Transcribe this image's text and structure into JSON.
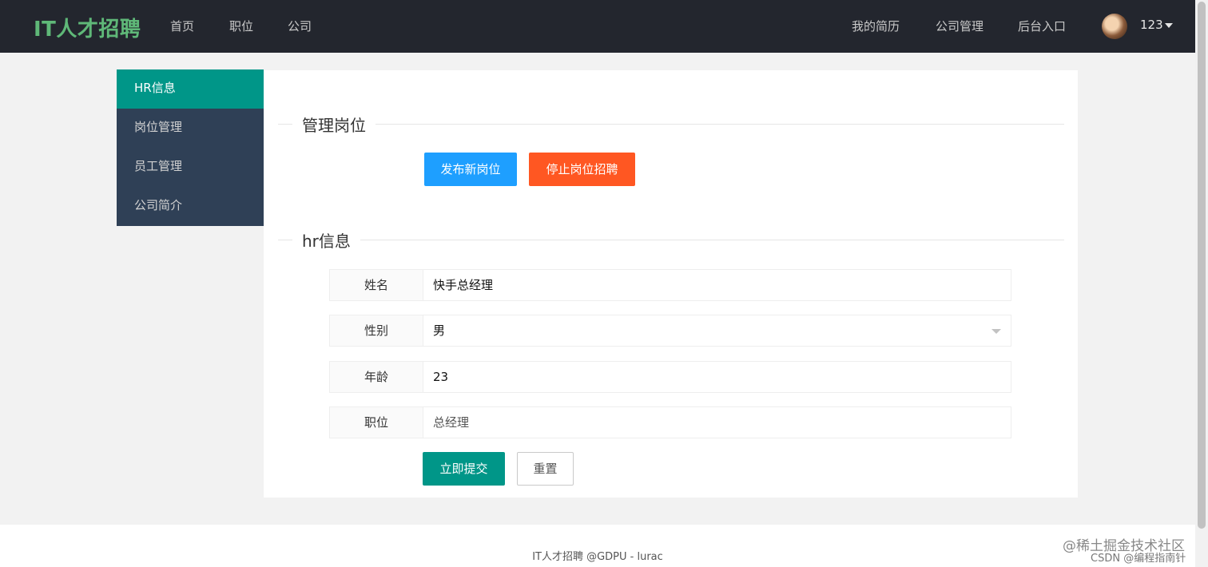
{
  "header": {
    "logo": "IT人才招聘",
    "nav_left": [
      "首页",
      "职位",
      "公司"
    ],
    "nav_right": [
      "我的简历",
      "公司管理",
      "后台入口"
    ],
    "user_name": "123"
  },
  "sidebar": {
    "items": [
      {
        "label": "HR信息"
      },
      {
        "label": "岗位管理"
      },
      {
        "label": "员工管理"
      },
      {
        "label": "公司简介"
      }
    ]
  },
  "main": {
    "manage_title": "管理岗位",
    "publish_button": "发布新岗位",
    "stop_button": "停止岗位招聘",
    "hr_title": "hr信息",
    "form": {
      "name_label": "姓名",
      "name_value": "快手总经理",
      "gender_label": "性别",
      "gender_value": "男",
      "age_label": "年龄",
      "age_value": "23",
      "position_label": "职位",
      "position_value": "总经理"
    },
    "submit_button": "立即提交",
    "reset_button": "重置"
  },
  "footer": {
    "text": "IT人才招聘 @GDPU - lurac"
  },
  "watermark": {
    "line1": "@稀土掘金技术社区",
    "line2": "CSDN @编程指南针"
  },
  "colors": {
    "header_bg": "#23262e",
    "logo": "#5fb878",
    "sidebar_bg": "#2f4056",
    "active": "#009688",
    "blue": "#1e9fff",
    "orange": "#ff5722"
  }
}
